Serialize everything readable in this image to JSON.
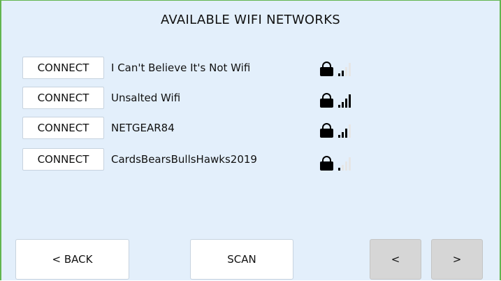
{
  "title": "AVAILABLE WIFI NETWORKS",
  "networks": [
    {
      "connect_label": "CONNECT",
      "ssid": "I Can't Believe It's Not Wifi",
      "locked": true,
      "signal_bars": 2
    },
    {
      "connect_label": "CONNECT",
      "ssid": "Unsalted Wifi",
      "locked": true,
      "signal_bars": 4
    },
    {
      "connect_label": "CONNECT",
      "ssid": "NETGEAR84",
      "locked": true,
      "signal_bars": 3
    },
    {
      "connect_label": "CONNECT",
      "ssid": "CardsBearsBullsHawks2019",
      "locked": true,
      "signal_bars": 1
    }
  ],
  "footer": {
    "back_label": "< BACK",
    "scan_label": "SCAN",
    "prev_label": "<",
    "next_label": ">"
  },
  "colors": {
    "background": "#e3effb",
    "border": "#62b54f",
    "button": "#ffffff",
    "nav_button": "#d6d6d6"
  }
}
